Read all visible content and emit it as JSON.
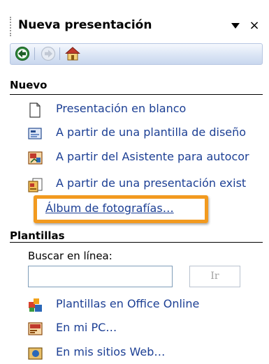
{
  "taskpane": {
    "title": "Nueva presentación",
    "dropdown_icon": "triangle-down",
    "close_label": "×"
  },
  "nav": {
    "back_icon": "back-arrow",
    "forward_icon": "forward-arrow",
    "home_icon": "home"
  },
  "nuevo": {
    "heading": "Nuevo",
    "items": [
      {
        "label": "Presentación en blanco",
        "icon": "blank-document"
      },
      {
        "label": "A partir de una plantilla de diseño",
        "icon": "design-template"
      },
      {
        "label": "A partir del Asistente para autocor",
        "icon": "autocontent-wizard"
      },
      {
        "label": "A partir de una presentación exist",
        "icon": "existing-presentation"
      }
    ],
    "album_link": "Álbum de fotografías…"
  },
  "plantillas": {
    "heading": "Plantillas",
    "search_label": "Buscar en línea:",
    "search_value": "",
    "go_label": "Ir",
    "items": [
      {
        "label": "Plantillas en Office Online",
        "icon": "office-online"
      },
      {
        "label": "En mi PC…",
        "icon": "my-pc"
      },
      {
        "label": "En mis sitios Web…",
        "icon": "my-websites"
      }
    ]
  },
  "colors": {
    "link": "#1c3f94",
    "highlight": "#f29a1f",
    "toolbar": "#dbe5f5"
  }
}
